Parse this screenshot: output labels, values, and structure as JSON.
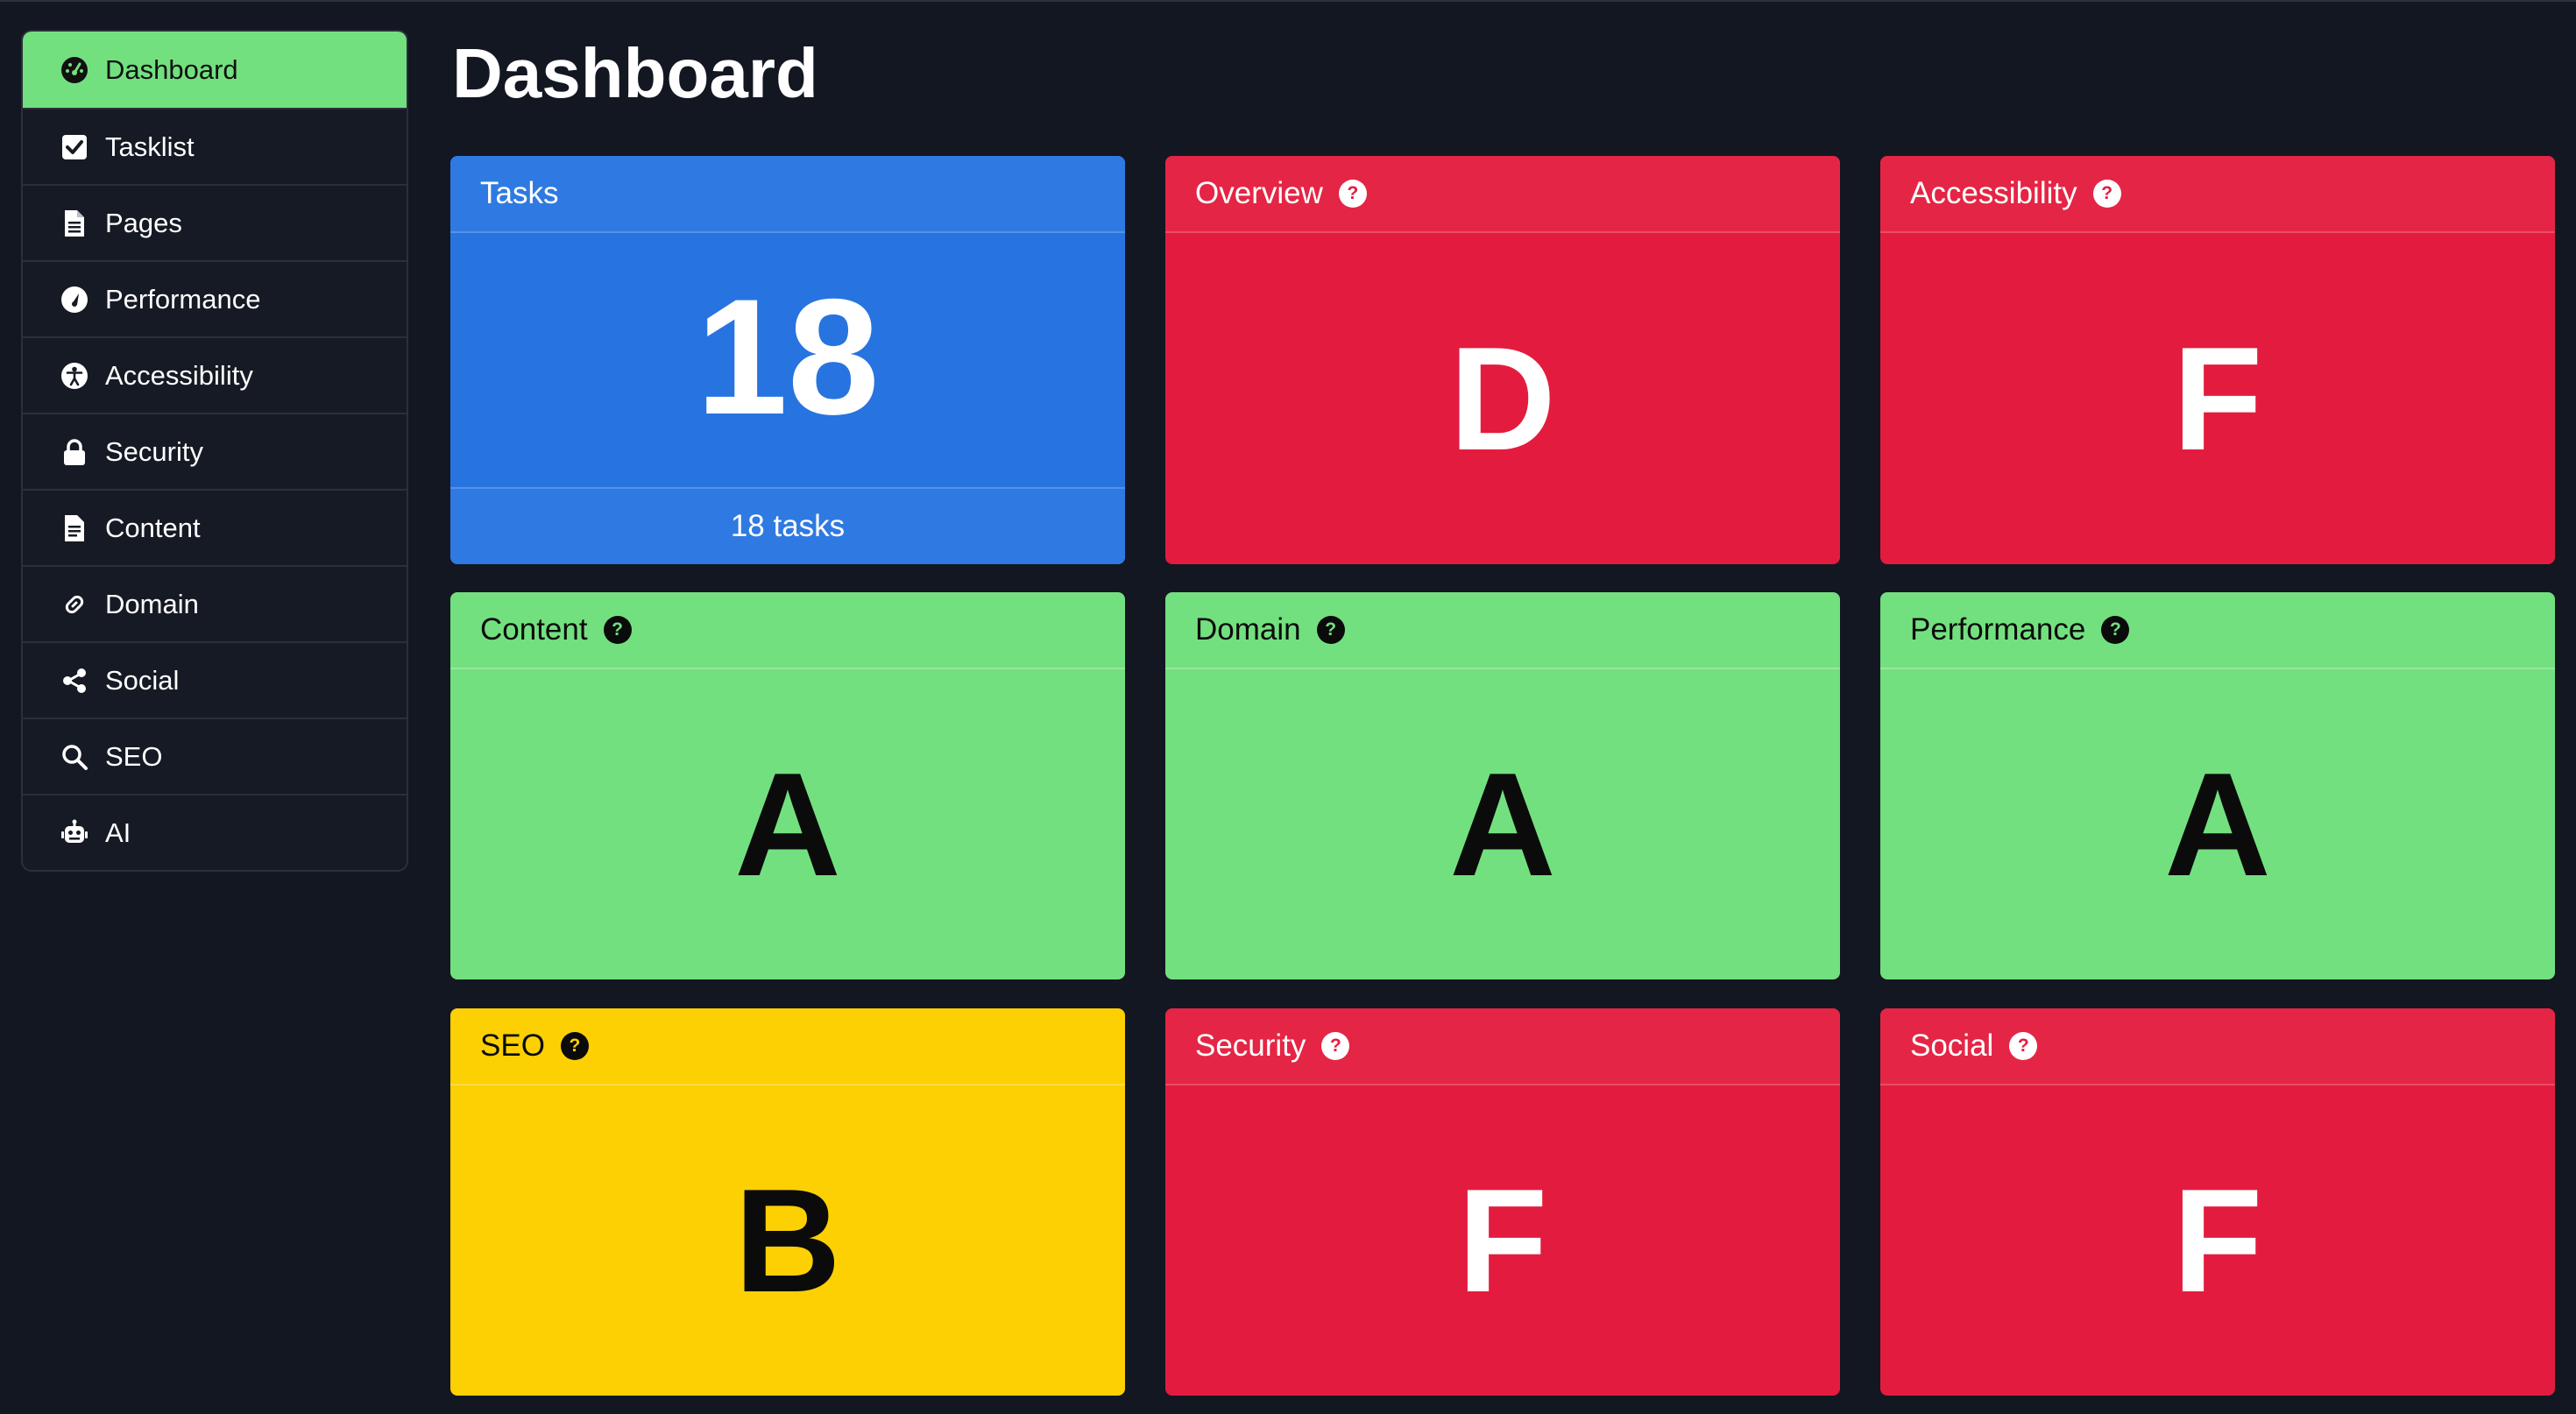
{
  "page": {
    "title": "Dashboard"
  },
  "sidebar": {
    "items": [
      {
        "label": "Dashboard",
        "icon": "dashboard-gauge-icon",
        "active": true
      },
      {
        "label": "Tasklist",
        "icon": "checkbox-icon",
        "active": false
      },
      {
        "label": "Pages",
        "icon": "document-icon",
        "active": false
      },
      {
        "label": "Performance",
        "icon": "speedometer-icon",
        "active": false
      },
      {
        "label": "Accessibility",
        "icon": "accessibility-icon",
        "active": false
      },
      {
        "label": "Security",
        "icon": "lock-icon",
        "active": false
      },
      {
        "label": "Content",
        "icon": "file-text-icon",
        "active": false
      },
      {
        "label": "Domain",
        "icon": "link-icon",
        "active": false
      },
      {
        "label": "Social",
        "icon": "share-icon",
        "active": false
      },
      {
        "label": "SEO",
        "icon": "search-icon",
        "active": false
      },
      {
        "label": "AI",
        "icon": "robot-icon",
        "active": false
      }
    ]
  },
  "cards": {
    "tasks": {
      "title": "Tasks",
      "count": "18",
      "footer": "18 tasks"
    },
    "overview": {
      "title": "Overview",
      "grade": "D"
    },
    "accessibility": {
      "title": "Accessibility",
      "grade": "F"
    },
    "content": {
      "title": "Content",
      "grade": "A"
    },
    "domain": {
      "title": "Domain",
      "grade": "A"
    },
    "performance": {
      "title": "Performance",
      "grade": "A"
    },
    "seo": {
      "title": "SEO",
      "grade": "B"
    },
    "security": {
      "title": "Security",
      "grade": "F"
    },
    "social": {
      "title": "Social",
      "grade": "F"
    }
  },
  "colors": {
    "background": "#131722",
    "grade_a": "#73e07f",
    "grade_b": "#fcd003",
    "grade_f": "#e31c3f",
    "tasks": "#2774e0"
  },
  "help_glyph": "?"
}
